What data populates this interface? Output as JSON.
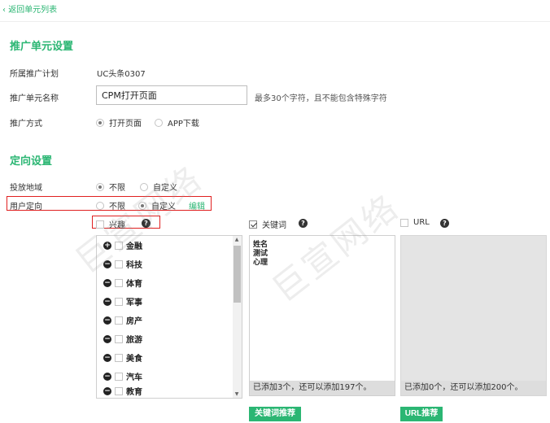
{
  "back_link": {
    "chevron": "‹",
    "label": "返回单元列表"
  },
  "sections": {
    "promo_unit": "推广单元设置",
    "targeting": "定向设置"
  },
  "form": {
    "campaign_label": "所属推广计划",
    "campaign_value": "UC头条0307",
    "unit_name_label": "推广单元名称",
    "unit_name_value": "CPM打开页面",
    "unit_name_hint": "最多30个字符，且不能包含特殊字符",
    "method_label": "推广方式",
    "method_options": [
      {
        "label": "打开页面",
        "checked": true
      },
      {
        "label": "APP下载",
        "checked": false
      }
    ]
  },
  "targeting": {
    "region_label": "投放地域",
    "region_options": [
      {
        "label": "不限",
        "checked": true
      },
      {
        "label": "自定义",
        "checked": false
      }
    ],
    "user_label": "用户定向",
    "user_options": [
      {
        "label": "不限",
        "checked": false
      },
      {
        "label": "自定义",
        "checked": true
      }
    ],
    "edit_label": "编辑"
  },
  "interest": {
    "label": "兴趣",
    "checked": false,
    "help": "?",
    "items": [
      {
        "label": "金融",
        "toggle": "+"
      },
      {
        "label": "科技",
        "toggle": "−"
      },
      {
        "label": "体育",
        "toggle": "−"
      },
      {
        "label": "军事",
        "toggle": "−"
      },
      {
        "label": "房产",
        "toggle": "−"
      },
      {
        "label": "旅游",
        "toggle": "−"
      },
      {
        "label": "美食",
        "toggle": "−"
      },
      {
        "label": "汽车",
        "toggle": "−"
      },
      {
        "label": "教育",
        "toggle": "−"
      }
    ]
  },
  "keywords": {
    "label": "关键词",
    "checked": true,
    "help": "?",
    "lines": [
      "姓名",
      "测试",
      "心理"
    ],
    "footer": "已添加3个，还可以添加197个。",
    "button": "关键词推荐"
  },
  "url": {
    "label": "URL",
    "checked": false,
    "help": "?",
    "footer": "已添加0个，还可以添加200个。",
    "button": "URL推荐"
  },
  "watermark": "巨宣网络",
  "colors": {
    "accent": "#2bb673",
    "highlight": "#e02020"
  }
}
